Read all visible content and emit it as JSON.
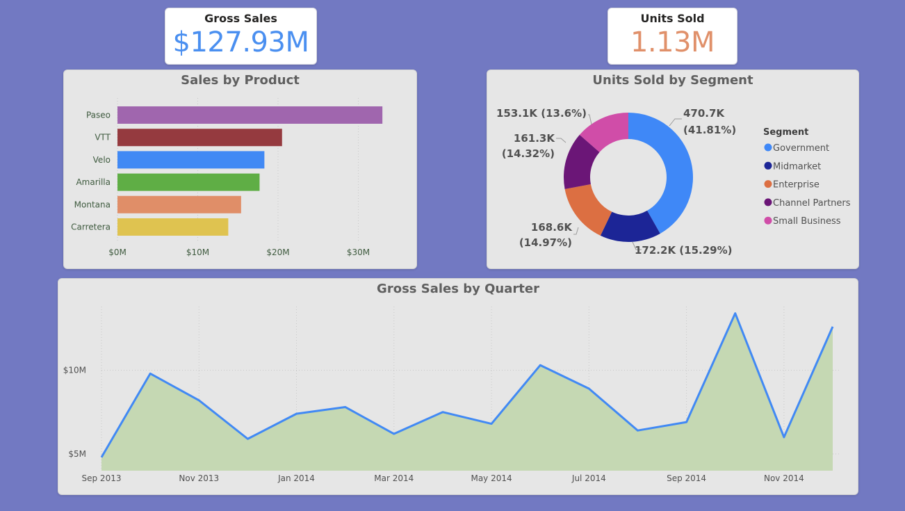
{
  "kpis": {
    "gross_sales": {
      "title": "Gross Sales",
      "value": "$127.93M",
      "color": "#4a8ff0"
    },
    "units_sold": {
      "title": "Units Sold",
      "value": "1.13M",
      "color": "#e0906a"
    }
  },
  "chart_data": [
    {
      "type": "bar",
      "orientation": "horizontal",
      "title": "Sales by Product",
      "categories": [
        "Paseo",
        "VTT",
        "Velo",
        "Amarilla",
        "Montana",
        "Carretera"
      ],
      "values": [
        33.0,
        20.5,
        18.3,
        17.7,
        15.4,
        13.8
      ],
      "colors": [
        "#a066ae",
        "#953a3f",
        "#4189f4",
        "#5fae45",
        "#e08e68",
        "#dfc350"
      ],
      "x_ticks": [
        "$0M",
        "$10M",
        "$20M",
        "$30M"
      ],
      "xlim": [
        0,
        35
      ],
      "grid": true
    },
    {
      "type": "pie",
      "variant": "donut",
      "title": "Units Sold by Segment",
      "legend_title": "Segment",
      "legend_position": "right",
      "series": [
        {
          "name": "Government",
          "value": 470.7,
          "label_value": "470.7K",
          "label_pct": "(41.81%)",
          "color": "#3f88f7"
        },
        {
          "name": "Midmarket",
          "value": 172.2,
          "label_value": "172.2K",
          "label_pct": "(15.29%)",
          "color": "#1c2596"
        },
        {
          "name": "Enterprise",
          "value": 168.6,
          "label_value": "168.6K",
          "label_pct": "(14.97%)",
          "color": "#dc6f42"
        },
        {
          "name": "Channel Partners",
          "value": 161.3,
          "label_value": "161.3K",
          "label_pct": "(14.32%)",
          "color": "#6b1677"
        },
        {
          "name": "Small Business",
          "value": 153.1,
          "label_value": "153.1K",
          "label_pct": "(13.6%)",
          "color": "#d04da8"
        }
      ]
    },
    {
      "type": "area",
      "title": "Gross Sales by Quarter",
      "x": [
        "Sep 2013",
        "Oct 2013",
        "Nov 2013",
        "Dec 2013",
        "Jan 2014",
        "Feb 2014",
        "Mar 2014",
        "Apr 2014",
        "May 2014",
        "Jun 2014",
        "Jul 2014",
        "Aug 2014",
        "Sep 2014",
        "Oct 2014",
        "Nov 2014",
        "Dec 2014"
      ],
      "x_tick_labels": [
        "Sep 2013",
        "Nov 2013",
        "Jan 2014",
        "Mar 2014",
        "May 2014",
        "Jul 2014",
        "Sep 2014",
        "Nov 2014"
      ],
      "values": [
        4.8,
        9.8,
        8.2,
        5.9,
        7.4,
        7.8,
        6.2,
        7.5,
        6.8,
        10.3,
        8.9,
        6.4,
        6.9,
        13.4,
        6.0,
        12.6
      ],
      "y_ticks": [
        5,
        10
      ],
      "y_tick_labels": [
        "$5M",
        "$10M"
      ],
      "ylim": [
        4,
        13.8
      ],
      "line_color": "#4189f4",
      "fill_color": "#c5d8b3",
      "grid": true
    }
  ]
}
